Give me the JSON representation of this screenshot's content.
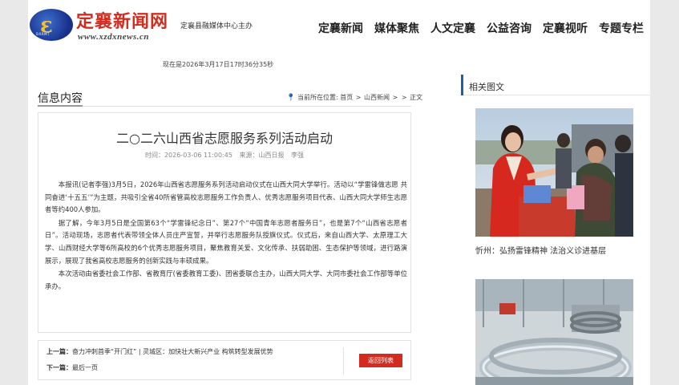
{
  "header": {
    "logo_caption": "DXRMT",
    "site_name": "定襄新闻网",
    "site_url": "www.xzdxnews.cn",
    "sub_title": "定襄县融媒体中心主办",
    "nav": [
      "定襄新闻",
      "媒体聚焦",
      "人文定襄",
      "公益咨询",
      "定襄视听",
      "专题专栏"
    ]
  },
  "now_text": "现在是2026年3月17日17时36分35秒",
  "section_title": "信息内容",
  "breadcrumb": {
    "prefix": "当前所在位置:",
    "items": [
      "首页",
      "山西新闻",
      "正文"
    ],
    "sep": ">"
  },
  "article": {
    "title": "二○二六山西省志愿服务系列活动启动",
    "time": "时间：2026-03-06 11:00:45",
    "source": "来源：山西日报",
    "author": "李强",
    "paragraphs": [
      "本报讯(记者李强)3月5日，2026年山西省志愿服务系列活动启动仪式在山西大同大学举行。活动以“学雷锋做志愿 共同奋进‘十五五’”为主题，共吸引全省40所省管高校志愿服务工作负责人、优秀志愿服务项目代表、山西大同大学师生志愿者等约400人参加。",
      "据了解，今年3月5日是全国第63个“学雷锋纪念日”、第27个“中国青年志愿者服务日”，也是第7个“山西省志愿者日”。活动现场，志愿者代表带领全体人员庄严宣誓，并举行志愿服务队授旗仪式。仪式后，来自山西大学、太原理工大学、山西财经大学等6所高校的6个优秀志愿服务项目，聚焦教育关爱、文化传承、扶弱助困、生态保护等领域，进行路演展示，展现了我省高校志愿服务的创新实践与丰硕成果。",
      "本次活动由省委社会工作部、省教育厅(省委教育工委)、团省委联合主办，山西大同大学、大同市委社会工作部等单位承办。"
    ]
  },
  "pager": {
    "prev_label": "上一篇：",
    "prev_text": "奋力冲刺首季“开门红” | 灵城区：加快壮大新兴产业 构筑转型发展优势",
    "next_label": "下一篇：",
    "next_text": "最后一页",
    "back_label": "返回列表"
  },
  "sidebar": {
    "title": "相关图文",
    "photo1_caption": "忻州：弘扬雷锋精神 法治义诊进基层"
  },
  "colors": {
    "brand_red": "#d42b1f",
    "accent_blue": "#1f5fa8"
  }
}
